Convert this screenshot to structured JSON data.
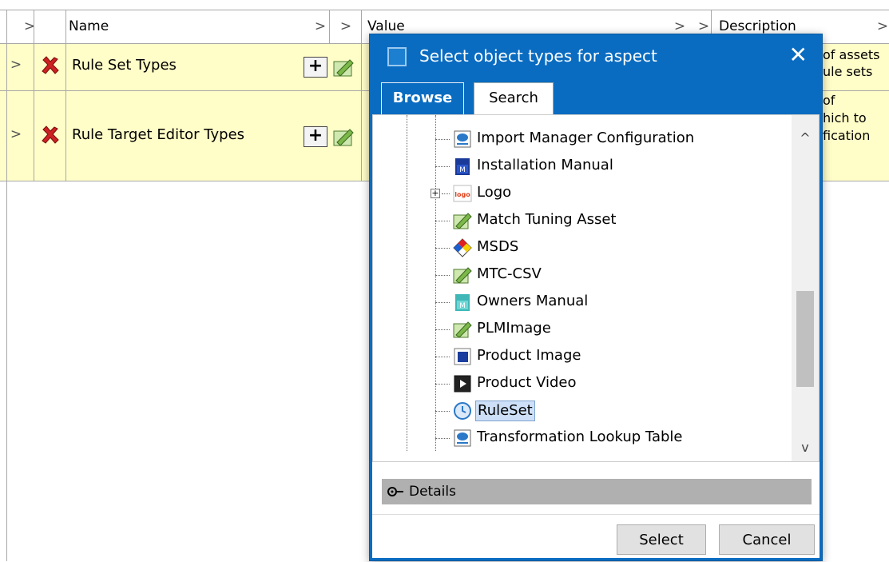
{
  "table": {
    "header": {
      "arrow": ">",
      "name": "Name",
      "value": "Value",
      "description": "Description"
    },
    "rows": [
      {
        "arrow": ">",
        "name": "Rule Set Types",
        "plus": "+",
        "desc_line1": "of assets",
        "desc_line2": "ule sets"
      },
      {
        "arrow": ">",
        "name": "Rule Target Editor Types",
        "plus": "+",
        "desc_line1": "of",
        "desc_line2": "hich to",
        "desc_line3": "fication"
      }
    ]
  },
  "dialog": {
    "title": "Select object types for aspect",
    "close": "✕",
    "tabs": {
      "browse": "Browse",
      "search": "Search"
    },
    "tree": [
      {
        "label": "Import Manager Configuration",
        "icon": "config-icon"
      },
      {
        "label": "Installation Manual",
        "icon": "manual-icon"
      },
      {
        "label": "Logo",
        "icon": "logo-icon",
        "expander": "+"
      },
      {
        "label": "Match Tuning Asset",
        "icon": "asset-icon"
      },
      {
        "label": "MSDS",
        "icon": "msds-icon"
      },
      {
        "label": "MTC-CSV",
        "icon": "asset-icon"
      },
      {
        "label": "Owners Manual",
        "icon": "manual-icon"
      },
      {
        "label": "PLMImage",
        "icon": "asset-icon"
      },
      {
        "label": "Product Image",
        "icon": "image-icon"
      },
      {
        "label": "Product Video",
        "icon": "video-icon"
      },
      {
        "label": "RuleSet",
        "icon": "clock-icon",
        "selected": true
      },
      {
        "label": "Transformation Lookup Table",
        "icon": "config-icon"
      }
    ],
    "scroll_up": "^",
    "scroll_down": "v",
    "details": "Details",
    "buttons": {
      "select": "Select",
      "cancel": "Cancel"
    }
  }
}
